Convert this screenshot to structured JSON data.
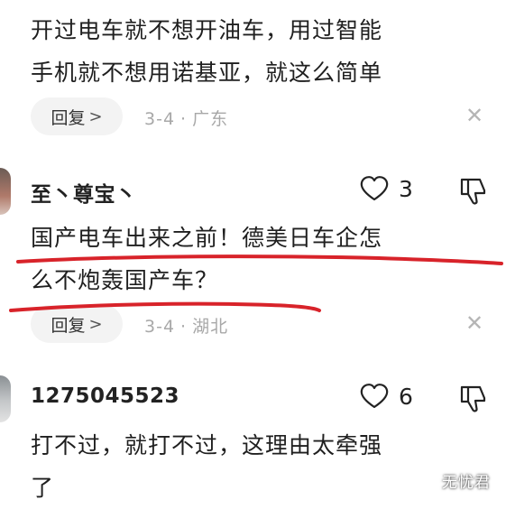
{
  "comments": [
    {
      "text_lines": [
        "开过电车就不想开油车，用过智能",
        "手机就不想用诺基亚，就这么简单"
      ],
      "reply_label": "回复",
      "date": "3-4",
      "location": "广东"
    },
    {
      "username": "至丶尊宝丶",
      "likes": "3",
      "text_lines": [
        "国产电车出来之前！德美日车企怎",
        "么不炮轰国产车？"
      ],
      "reply_label": "回复",
      "date": "3-4",
      "location": "湖北"
    },
    {
      "username": "1275045523",
      "likes": "6",
      "text_lines": [
        "打不过，就打不过，这理由太牵强",
        "了"
      ]
    }
  ],
  "icons": {
    "reply_chevron": ">",
    "close": "✕",
    "separator": "·",
    "like": "heart-icon",
    "dislike": "thumbs-down-icon"
  },
  "watermark": "无忧君",
  "colors": {
    "text": "#1f1f1f",
    "meta": "#a8a8a8",
    "reply_bg": "#f3f3f3",
    "annotation_red": "#d8232a"
  }
}
